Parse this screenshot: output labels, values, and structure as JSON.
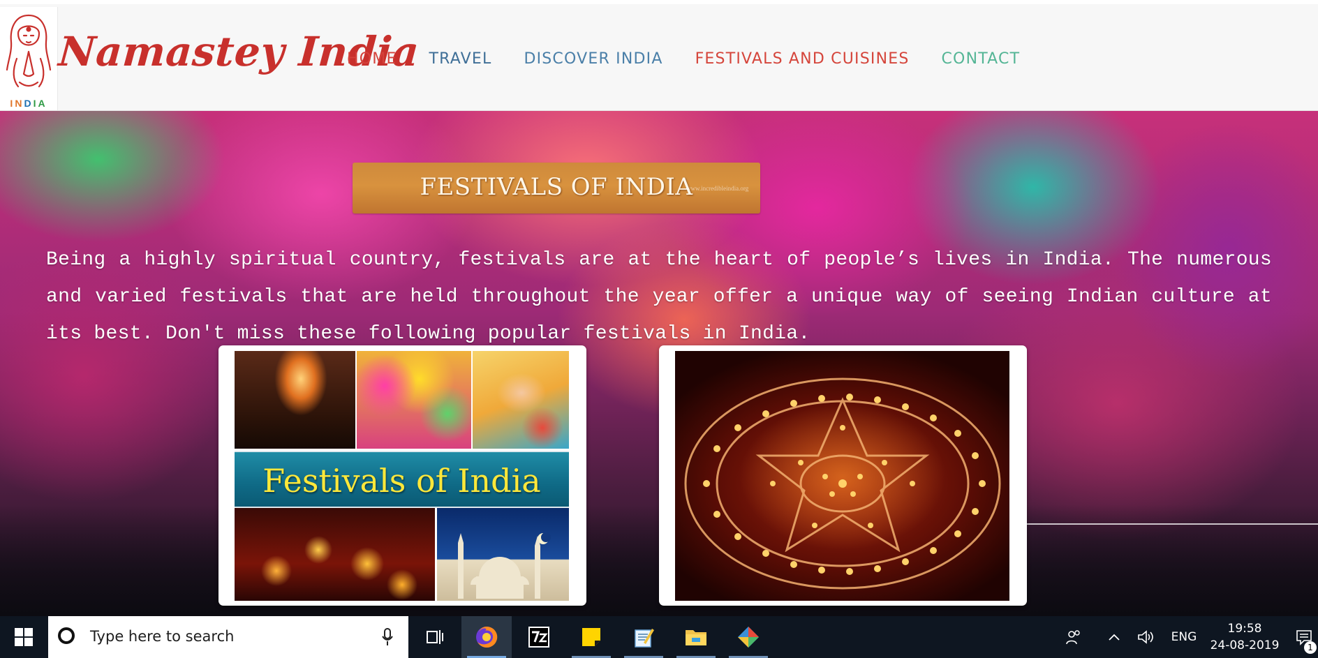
{
  "header": {
    "logo_icon": "namaste-woman-logo",
    "logo_word": [
      "I",
      "N",
      "D",
      "I",
      "A"
    ],
    "brand": "Namastey India",
    "nav": [
      {
        "label": "HOME",
        "color": "#d5423b"
      },
      {
        "label": "TRAVEL",
        "color": "#3f6f97"
      },
      {
        "label": "DISCOVER INDIA",
        "color": "#4a7fa8"
      },
      {
        "label": "FESTIVALS AND CUISINES",
        "color": "#d5453b"
      },
      {
        "label": "CONTACT",
        "color": "#54b595"
      }
    ]
  },
  "main": {
    "title_banner": "FESTIVALS OF INDIA",
    "title_watermark": "www.incredibleindia.org",
    "intro": "Being a highly spiritual country, festivals are at the heart of people’s lives in India. The numerous and varied festivals that are held throughout the year offer a unique way of seeing Indian culture at its best. Don't miss these following popular festivals in India.",
    "card_1": {
      "banner_text": "Festivals of India"
    },
    "card_2": {
      "image": "diwali-lamps-rangoli"
    }
  },
  "taskbar": {
    "search_placeholder": "Type here to search",
    "apps": [
      "task-view-icon",
      "firefox-icon",
      "7zip-icon",
      "sticky-notes-icon",
      "notepad-icon",
      "file-explorer-icon",
      "snipping-tool-icon"
    ],
    "language": "ENG",
    "time": "19:58",
    "date": "24-08-2019",
    "notification_count": "1"
  }
}
